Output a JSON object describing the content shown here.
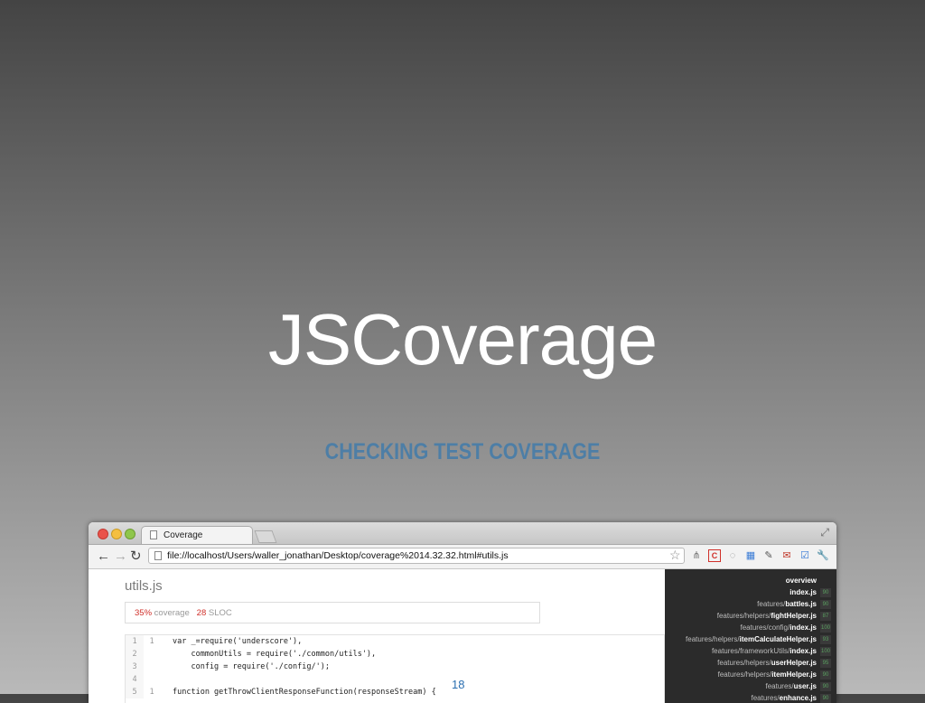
{
  "slide": {
    "title": "JSCoverage",
    "subtitle": "CHECKING TEST COVERAGE",
    "page_number": "18"
  },
  "browser": {
    "tab_title": "Coverage",
    "url": "file://localhost/Users/waller_jonathan/Desktop/coverage%2014.32.32.html#utils.js",
    "icons": [
      "back-arrow-icon",
      "forward-arrow-icon",
      "reload-icon",
      "bookmark-star-icon",
      "resize-icon"
    ],
    "extensions": [
      "extension-icon",
      "c-extension-icon",
      "circle-extension-icon",
      "grid-extension-icon",
      "pin-extension-icon",
      "gmail-icon",
      "check-icon",
      "wrench-icon"
    ],
    "colors": {
      "close": "#e9534b",
      "minimize": "#f4bf40",
      "zoom": "#8fc64b"
    }
  },
  "report": {
    "file_title": "utils.js",
    "coverage_percent": "35%",
    "coverage_label": "coverage",
    "sloc_count": "28",
    "sloc_label": "SLOC",
    "colors": {
      "percent": "#d0302a"
    },
    "code_lines": [
      {
        "ln": "1",
        "hits": "1",
        "src": "var _=require('underscore'),"
      },
      {
        "ln": "2",
        "hits": "",
        "src": "    commonUtils = require('./common/utils'),"
      },
      {
        "ln": "3",
        "hits": "",
        "src": "    config = require('./config/');"
      },
      {
        "ln": "4",
        "hits": "",
        "src": ""
      },
      {
        "ln": "5",
        "hits": "1",
        "src": "function getThrowClientResponseFunction(responseStream) {"
      }
    ]
  },
  "sidebar": {
    "items": [
      {
        "prefix": "",
        "name": "overview",
        "badge": ""
      },
      {
        "prefix": "",
        "name": "index.js",
        "badge": "90"
      },
      {
        "prefix": "features/",
        "name": "battles.js",
        "badge": "90"
      },
      {
        "prefix": "features/helpers/",
        "name": "fightHelper.js",
        "badge": "87"
      },
      {
        "prefix": "features/config/",
        "name": "index.js",
        "badge": "100"
      },
      {
        "prefix": "features/helpers/",
        "name": "itemCalculateHelper.js",
        "badge": "93"
      },
      {
        "prefix": "features/frameworkUtils/",
        "name": "index.js",
        "badge": "100"
      },
      {
        "prefix": "features/helpers/",
        "name": "userHelper.js",
        "badge": "95"
      },
      {
        "prefix": "features/helpers/",
        "name": "itemHelper.js",
        "badge": "90"
      },
      {
        "prefix": "features/",
        "name": "user.js",
        "badge": "90"
      },
      {
        "prefix": "features/",
        "name": "enhance.js",
        "badge": "90"
      }
    ]
  }
}
